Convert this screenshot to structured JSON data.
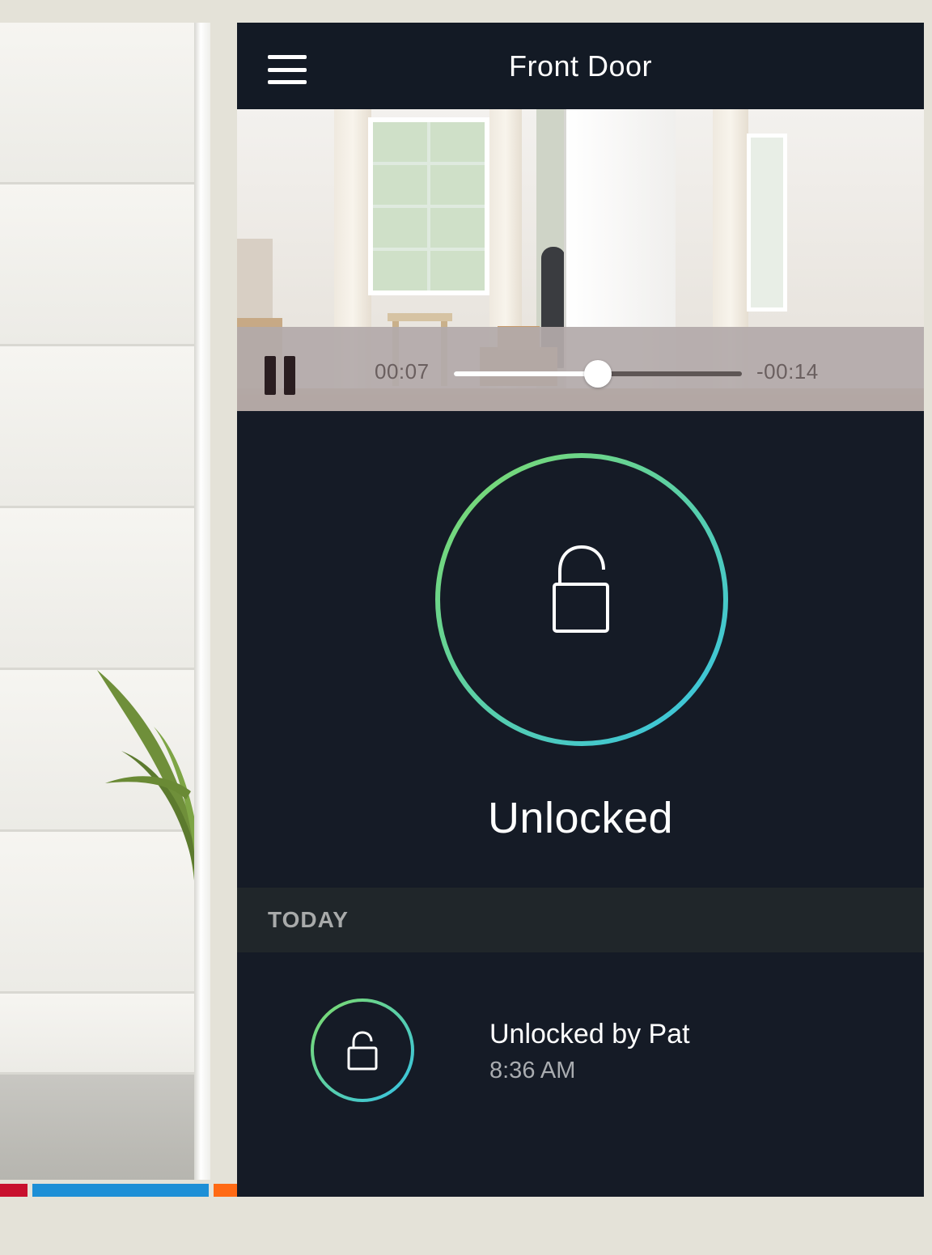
{
  "app": {
    "title": "Front Door",
    "menu_icon": "hamburger-menu-icon"
  },
  "video": {
    "elapsed": "00:07",
    "remaining": "-00:14",
    "progress": 0.5,
    "pause_icon": "pause-icon"
  },
  "lock": {
    "status": "Unlocked",
    "icon": "unlocked-padlock-icon",
    "ring_colors": [
      "#7fdb6a",
      "#35c3e6"
    ]
  },
  "history": {
    "section_label": "TODAY",
    "events": [
      {
        "title": "Unlocked by Pat",
        "time": "8:36 AM"
      }
    ]
  },
  "colors": {
    "app_background": "#151b26",
    "accent_green": "#7fdb6a",
    "accent_blue": "#35c3e6"
  }
}
